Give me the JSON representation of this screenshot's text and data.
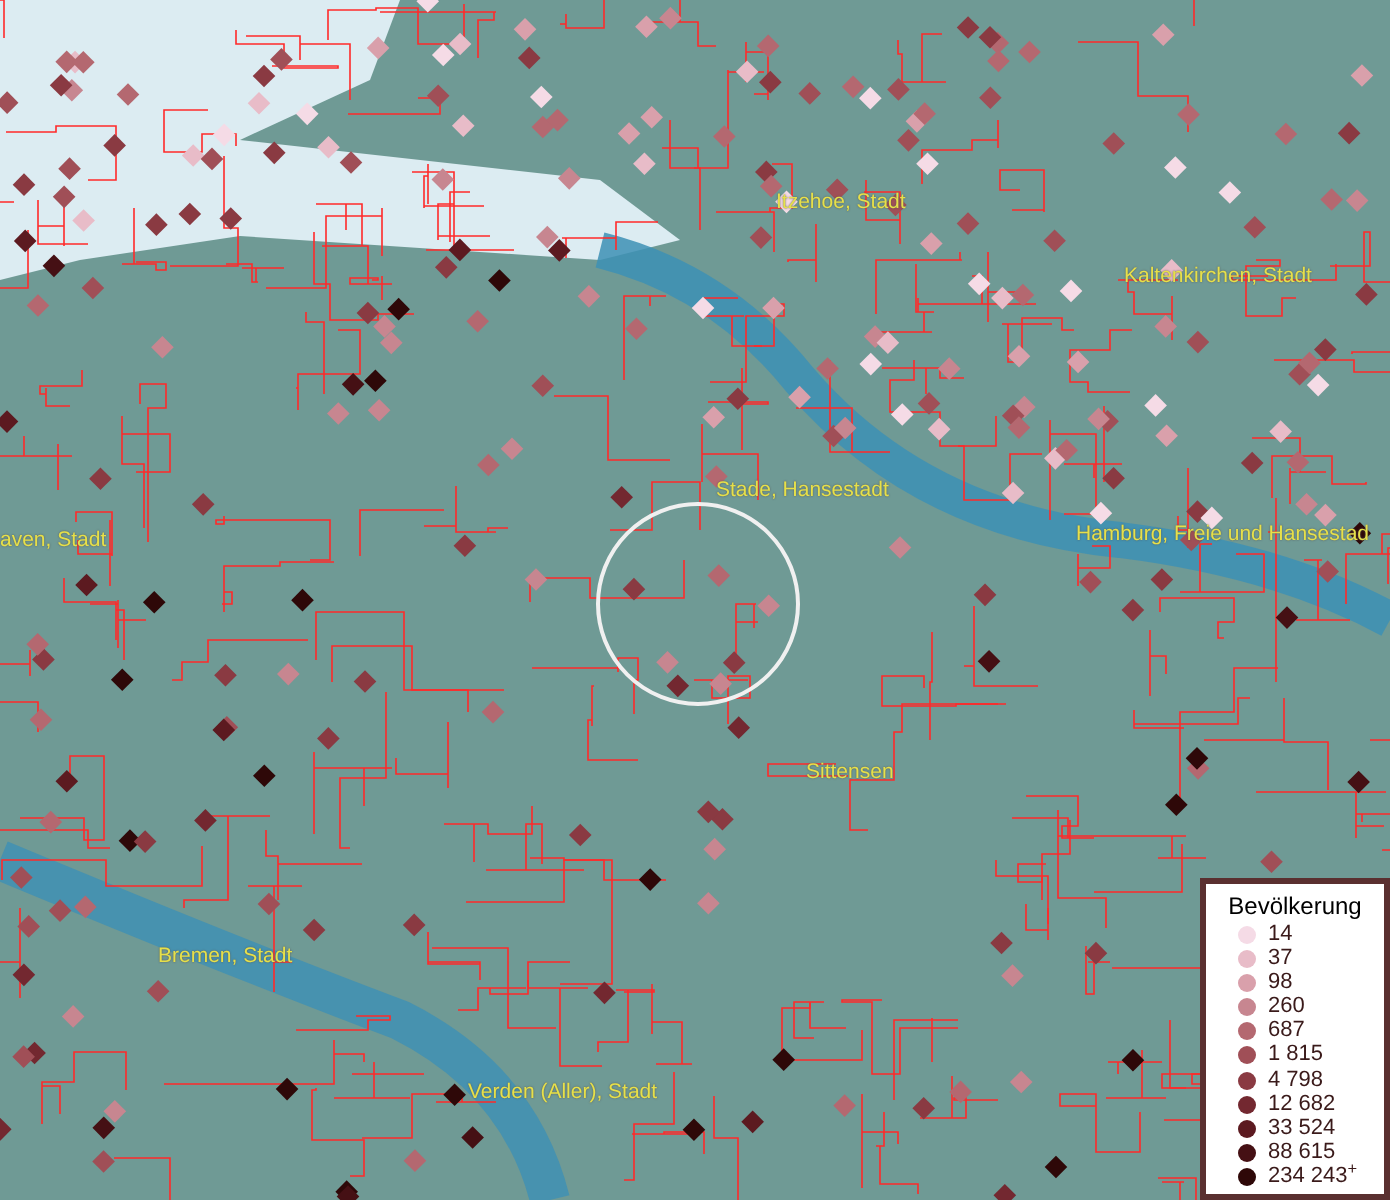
{
  "map": {
    "place_labels": [
      {
        "text": "Itzehoe, Stadt"
      },
      {
        "text": "Kaltenkirchen, Stadt"
      },
      {
        "text": "Stade, Hansestadt"
      },
      {
        "text": "aven, Stadt"
      },
      {
        "text": "Hamburg, Freie und Hansestad"
      },
      {
        "text": "Sittensen"
      },
      {
        "text": "Bremen, Stadt"
      },
      {
        "text": "Verden (Aller), Stadt"
      }
    ]
  },
  "legend": {
    "title": "Bevölkerung",
    "items": [
      {
        "label": "14",
        "color": "#f5dbe6"
      },
      {
        "label": "37",
        "color": "#e8bcc8"
      },
      {
        "label": "98",
        "color": "#d9a0ab"
      },
      {
        "label": "260",
        "color": "#c78690"
      },
      {
        "label": "687",
        "color": "#b46870"
      },
      {
        "label": "1 815",
        "color": "#a04f57"
      },
      {
        "label": "4 798",
        "color": "#8a3a42"
      },
      {
        "label": "12 682",
        "color": "#732830"
      },
      {
        "label": "33 524",
        "color": "#5c1a20"
      },
      {
        "label": "88 615",
        "color": "#451014"
      },
      {
        "label": "234 243$^{+}$",
        "color": "#2e0808"
      }
    ]
  }
}
